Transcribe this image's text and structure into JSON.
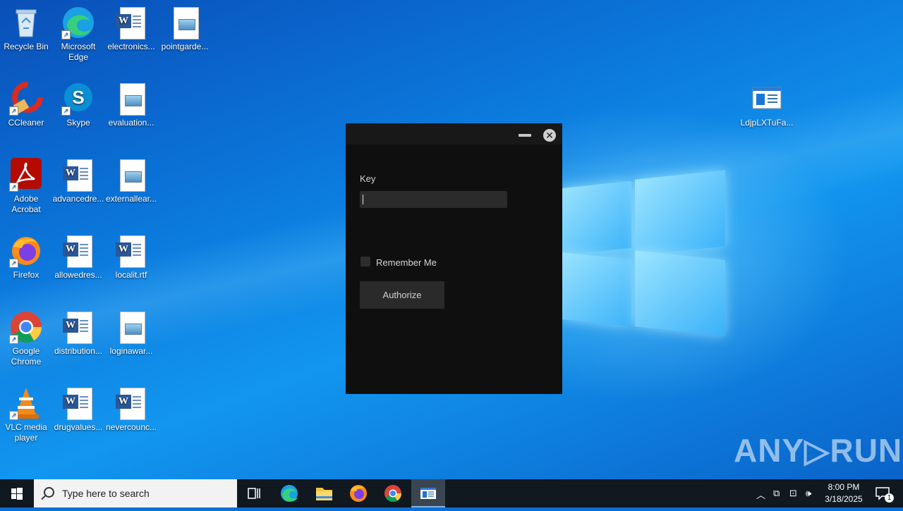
{
  "desktop": {
    "icons": [
      {
        "label": "Recycle Bin"
      },
      {
        "label": "Microsoft Edge"
      },
      {
        "label": "electronics..."
      },
      {
        "label": "pointgarde..."
      },
      {
        "label": "CCleaner"
      },
      {
        "label": "Skype"
      },
      {
        "label": "evaluation..."
      },
      {
        "label": "Adobe Acrobat"
      },
      {
        "label": "advancedre..."
      },
      {
        "label": "externallear..."
      },
      {
        "label": "Firefox"
      },
      {
        "label": "allowedres..."
      },
      {
        "label": "localit.rtf"
      },
      {
        "label": "Google Chrome"
      },
      {
        "label": "distribution..."
      },
      {
        "label": "loginawar..."
      },
      {
        "label": "VLC media player"
      },
      {
        "label": "drugvalues..."
      },
      {
        "label": "nevercounc..."
      },
      {
        "label": "LdjpLXTuFa..."
      }
    ]
  },
  "dialog": {
    "key_label": "Key",
    "key_value": "",
    "remember_label": "Remember Me",
    "authorize_label": "Authorize",
    "close_glyph": "✕"
  },
  "watermark": "ANY▷RUN",
  "taskbar": {
    "search_placeholder": "Type here to search",
    "pinned": [
      "task-view-icon",
      "edge-icon",
      "file-explorer-icon",
      "firefox-icon",
      "chrome-icon",
      "app-window-icon"
    ],
    "time": "8:00 PM",
    "date": "3/18/2025",
    "notification_count": "1"
  }
}
